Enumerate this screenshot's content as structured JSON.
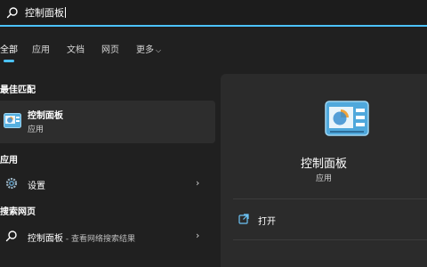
{
  "search": {
    "value": "控制面板"
  },
  "tabs": [
    {
      "label": "全部"
    },
    {
      "label": "应用"
    },
    {
      "label": "文档"
    },
    {
      "label": "网页"
    },
    {
      "label": "更多"
    }
  ],
  "sections": {
    "best_match": "最佳匹配",
    "apps": "应用",
    "web": "搜索网页"
  },
  "best_match": {
    "title": "控制面板",
    "subtitle": "应用"
  },
  "apps_list": [
    {
      "label": "设置"
    }
  ],
  "web_list": [
    {
      "label": "控制面板",
      "suffix": " - 查看网络搜索结果"
    }
  ],
  "detail": {
    "title": "控制面板",
    "subtitle": "应用",
    "actions": [
      {
        "label": "打开"
      }
    ]
  },
  "colors": {
    "accent": "#4cc2ff",
    "background": "#202020",
    "pane": "#2b2b2b"
  }
}
